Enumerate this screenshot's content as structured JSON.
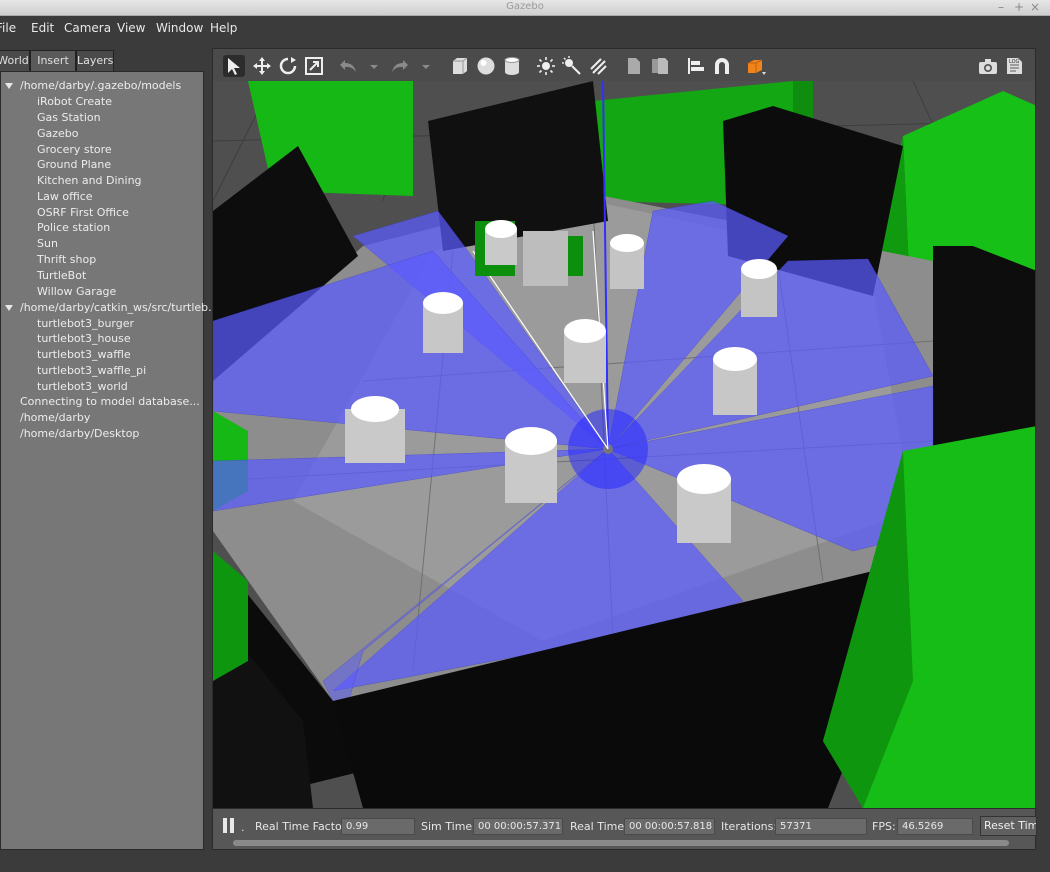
{
  "window": {
    "title": "Gazebo",
    "controls": [
      "–",
      "+",
      "×"
    ]
  },
  "menu": [
    "File",
    "Edit",
    "Camera",
    "View",
    "Window",
    "Help"
  ],
  "left_tabs": [
    "World",
    "Insert",
    "Layers"
  ],
  "tree": {
    "group1_path": "/home/darby/.gazebo/models",
    "group1_items": [
      "iRobot Create",
      "Gas Station",
      "Gazebo",
      "Grocery store",
      "Ground Plane",
      "Kitchen and Dining",
      "Law office",
      "OSRF First Office",
      "Police station",
      "Sun",
      "Thrift shop",
      "TurtleBot",
      "Willow Garage"
    ],
    "group2_path": "/home/darby/catkin_ws/src/turtleb...",
    "group2_items": [
      "turtlebot3_burger",
      "turtlebot3_house",
      "turtlebot3_waffle",
      "turtlebot3_waffle_pi",
      "turtlebot3_world"
    ],
    "extra": [
      "Connecting to model database...",
      "/home/darby",
      "/home/darby/Desktop"
    ]
  },
  "toolbar_icons": [
    "select-arrow-icon",
    "translate-icon",
    "rotate-icon",
    "scale-icon",
    "undo-icon",
    "redo-icon",
    "box-icon",
    "sphere-icon",
    "cylinder-icon",
    "point-light-icon",
    "spot-light-icon",
    "directional-light-icon",
    "copy-icon",
    "paste-icon",
    "align-icon",
    "snap-icon",
    "view-angle-icon",
    "screenshot-icon",
    "log-icon"
  ],
  "status": {
    "rtf_label": "Real Time Factor:",
    "rtf_value": "0.99",
    "sim_label": "Sim Time:",
    "sim_value": "00 00:00:57.371",
    "real_label": "Real Time:",
    "real_value": "00 00:00:57.818",
    "iter_label": "Iterations:",
    "iter_value": "57371",
    "fps_label": "FPS:",
    "fps_value": "46.5269",
    "reset_label": "Reset Time",
    "step_label": "."
  },
  "colors": {
    "laser": "#5a5aff",
    "wall": "#0a0a0a",
    "green": "#14b414",
    "floor": "#9a9a9a"
  }
}
